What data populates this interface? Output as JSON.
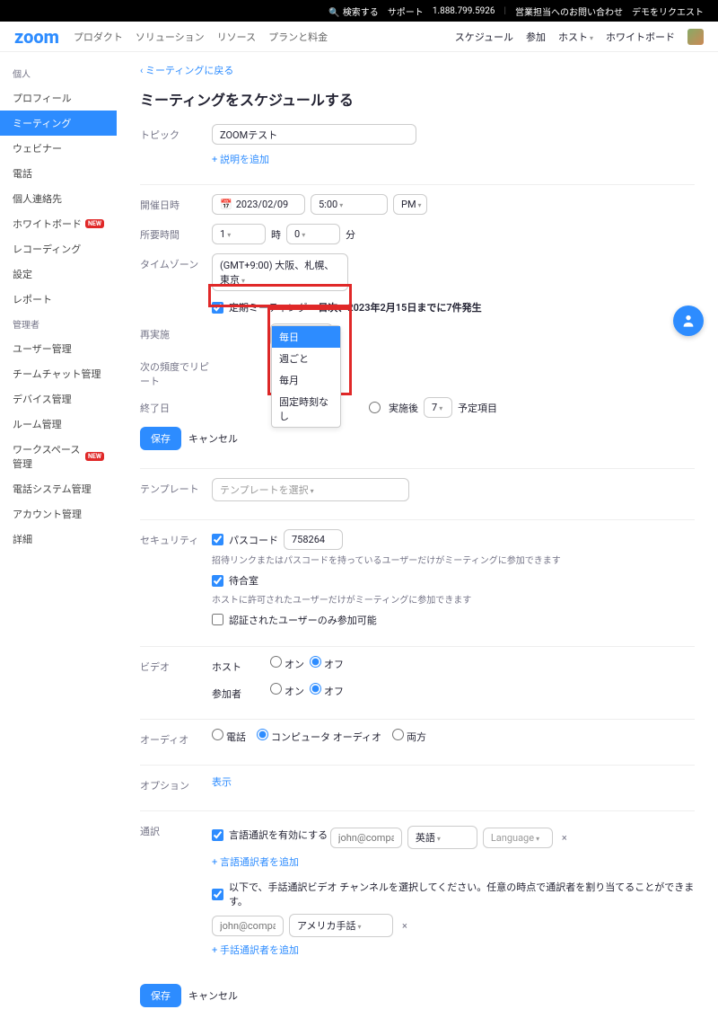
{
  "topbar": {
    "search": "検索する",
    "support": "サポート",
    "phone": "1.888.799.5926",
    "contact": "営業担当へのお問い合わせ",
    "demo": "デモをリクエスト"
  },
  "brand": "zoom",
  "nav": {
    "product": "プロダクト",
    "solution": "ソリューション",
    "resource": "リソース",
    "plan": "プランと料金"
  },
  "nav_right": {
    "schedule": "スケジュール",
    "join": "参加",
    "host": "ホスト",
    "whiteboard": "ホワイトボード"
  },
  "sidebar": {
    "personal": "個人",
    "items_personal": [
      {
        "label": "プロフィール"
      },
      {
        "label": "ミーティング",
        "active": true
      },
      {
        "label": "ウェビナー"
      },
      {
        "label": "電話"
      },
      {
        "label": "個人連絡先"
      },
      {
        "label": "ホワイトボード",
        "new": true
      },
      {
        "label": "レコーディング"
      },
      {
        "label": "設定"
      },
      {
        "label": "レポート"
      }
    ],
    "admin": "管理者",
    "items_admin": [
      {
        "label": "ユーザー管理"
      },
      {
        "label": "チームチャット管理"
      },
      {
        "label": "デバイス管理"
      },
      {
        "label": "ルーム管理"
      },
      {
        "label": "ワークスペース管理",
        "new": true
      },
      {
        "label": "電話システム管理"
      },
      {
        "label": "アカウント管理"
      },
      {
        "label": "詳細"
      }
    ],
    "new_badge": "NEW"
  },
  "back": "‹ ミーティングに戻る",
  "title": "ミーティングをスケジュールする",
  "labels": {
    "topic": "トピック",
    "add_desc": "+ 説明を追加",
    "when": "開催日時",
    "duration": "所要時間",
    "timezone": "タイムゾーン",
    "recurring": "定期ミーティング",
    "recurring_note": "日次、2023年2月15日までに7件発生",
    "recurrence": "再実施",
    "repeat_freq": "次の頻度でリピート",
    "end_date": "終了日",
    "occurrences_after": "実施後",
    "occurrences_unit": "予定項目",
    "template": "テンプレート",
    "security": "セキュリティ",
    "passcode": "パスコード",
    "passcode_hint": "招待リンクまたはパスコードを持っているユーザーだけがミーティングに参加できます",
    "waiting_room": "待合室",
    "waiting_hint": "ホストに許可されたユーザーだけがミーティングに参加できます",
    "authenticated": "認証されたユーザーのみ参加可能",
    "video": "ビデオ",
    "host": "ホスト",
    "participant": "参加者",
    "on": "オン",
    "off": "オフ",
    "audio": "オーディオ",
    "audio_phone": "電話",
    "audio_computer": "コンピュータ オーディオ",
    "audio_both": "両方",
    "options": "オプション",
    "show": "表示",
    "interpretation": "通訳",
    "enable_lang": "言語通訳を有効にする",
    "language": "英語",
    "language_ph": "Language",
    "add_lang_interp": "+ 言語通訳者を追加",
    "sign_note": "以下で、手話通訳ビデオ チャンネルを選択してください。任意の時点で通訳者を割り当てることができます。",
    "sign_lang": "アメリカ手話",
    "add_sign_interp": "+ 手話通訳者を追加",
    "hr": "時",
    "min": "分",
    "save": "保存",
    "cancel": "キャンセル"
  },
  "values": {
    "topic": "ZOOMテスト",
    "date": "2023/02/09",
    "time": "5:00",
    "ampm": "PM",
    "dur_hr": "1",
    "dur_min": "0",
    "timezone": "(GMT+9:00) 大阪、札幌、東京",
    "recurrence": "毎日",
    "occurrences": "7",
    "template_ph": "テンプレートを選択",
    "passcode": "758264",
    "email_ph": "john@company.com"
  },
  "recurrence_options": [
    "毎日",
    "週ごと",
    "毎月",
    "固定時刻なし"
  ]
}
